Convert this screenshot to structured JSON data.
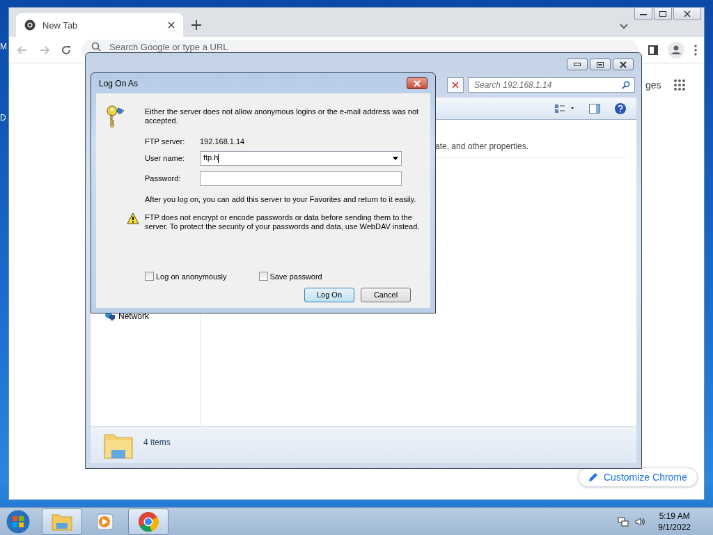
{
  "desktop": {
    "edge_labels": [
      "M",
      "D"
    ]
  },
  "browser": {
    "tabs": [
      {
        "title": "New Tab",
        "selected": true
      }
    ],
    "omnibox": {
      "placeholder": "Search Google or type a URL"
    },
    "link": "ges",
    "customize_button": "Customize Chrome"
  },
  "explorer": {
    "search": {
      "placeholder": "Search 192.168.1.14"
    },
    "hint": "ate, and other properties.",
    "nav_items": [
      "Network"
    ],
    "status": "4 items"
  },
  "dialog": {
    "title": "Log On As",
    "message": "Either the server does not allow anonymous logins or the e-mail address was not accepted.",
    "fields": [
      {
        "label": "FTP server:",
        "kind": "static",
        "value": "192.168.1.14"
      },
      {
        "label": "User name:",
        "kind": "combo",
        "value": "ftp.h"
      },
      {
        "label": "Password:",
        "kind": "password"
      }
    ],
    "info": "After you log on, you can add this server to your Favorites and return to it easily.",
    "warning": "FTP does not encrypt or encode passwords or data before sending them to the server.  To protect the security of your passwords and data, use WebDAV instead.",
    "checkboxes": [
      {
        "label": "Log on anonymously",
        "checked": false
      },
      {
        "label": "Save password",
        "checked": false
      }
    ],
    "buttons": [
      {
        "label": "Log On",
        "default": true
      },
      {
        "label": "Cancel",
        "default": false
      }
    ]
  },
  "taskbar": {
    "apps": [
      {
        "kind": "explorer",
        "selected": true
      },
      {
        "kind": "media",
        "selected": false
      },
      {
        "kind": "chrome",
        "selected": true
      }
    ],
    "time": "5:19 AM",
    "date": "9/1/2022"
  }
}
